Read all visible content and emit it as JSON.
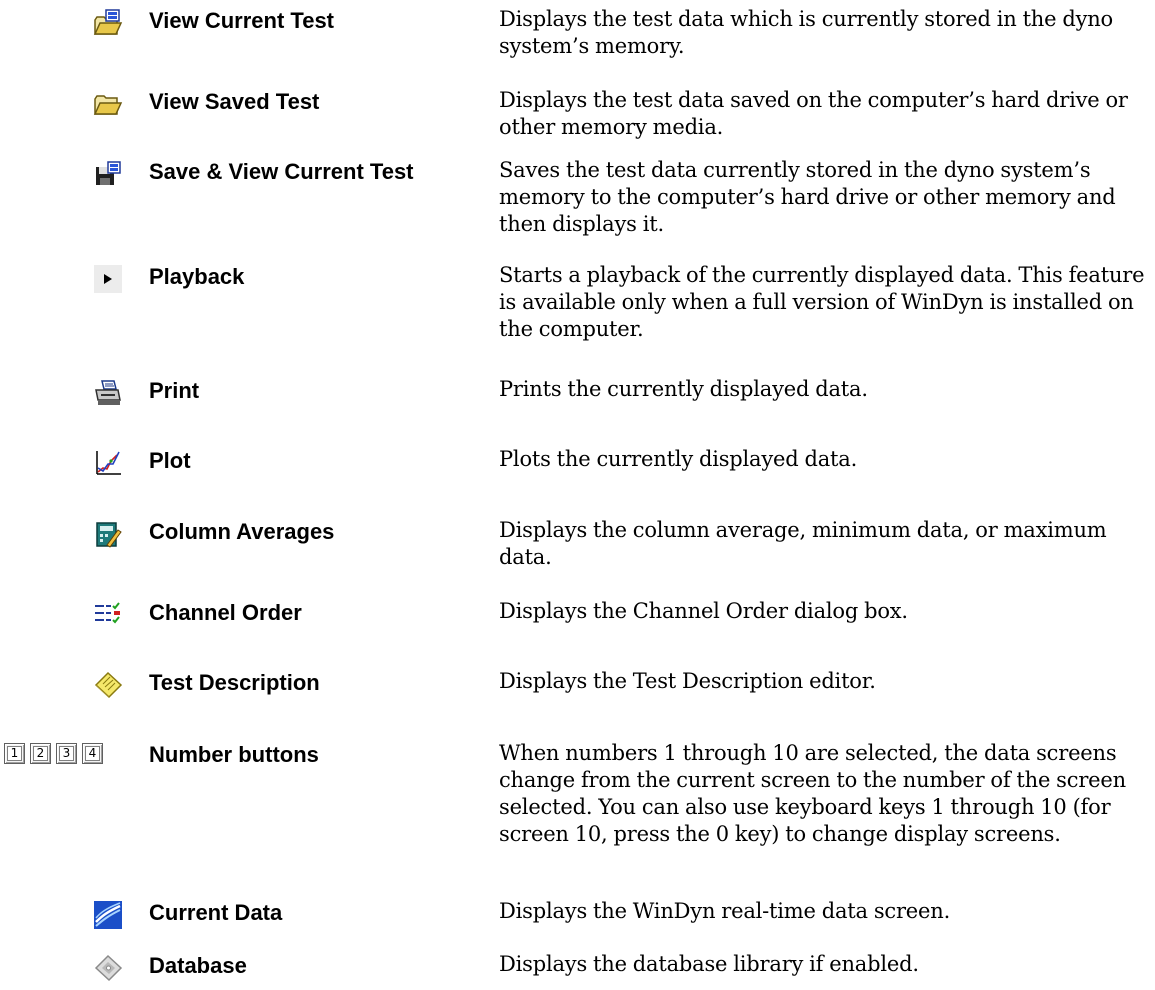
{
  "rows": [
    {
      "icon": "open-current-test-icon",
      "label": "View Current Test",
      "desc": "Displays the test data which is currently stored in the dyno system’s memory."
    },
    {
      "icon": "open-folder-icon",
      "label": "View Saved Test",
      "desc": "Displays the test data saved on the computer’s hard drive or other memory media."
    },
    {
      "icon": "save-disk-icon",
      "label": "Save & View Current Test",
      "desc": "Saves the test data currently stored in the dyno system’s memory to the computer’s hard drive or other memory and then displays it."
    },
    {
      "icon": "play-icon",
      "label": "Playback",
      "desc": "Starts a playback of the currently displayed data. This feature is available only when a full version of WinDyn is installed on the computer."
    },
    {
      "icon": "printer-icon",
      "label": "Print",
      "desc": "Prints the currently displayed data."
    },
    {
      "icon": "plot-chart-icon",
      "label": "Plot",
      "desc": "Plots the currently displayed data."
    },
    {
      "icon": "calculator-pencil-icon",
      "label": "Column Averages",
      "desc": "Displays the column average, minimum data, or maximum data."
    },
    {
      "icon": "channel-list-icon",
      "label": "Channel Order",
      "desc": "Displays the Channel Order dialog box."
    },
    {
      "icon": "note-pad-icon",
      "label": "Test Description",
      "desc": "Displays the Test Description editor."
    },
    {
      "icon": "number-buttons-icon",
      "label": "Number buttons",
      "numbers": [
        "1",
        "2",
        "3",
        "4"
      ],
      "desc": "When numbers 1 through 10 are selected, the data screens change from the current screen to the number of the screen selected. You can also use keyboard keys 1 through 10 (for screen 10, press the 0 key) to change display screens."
    },
    {
      "icon": "current-data-wave-icon",
      "label": "Current Data",
      "desc": "Displays the WinDyn real-time data screen."
    },
    {
      "icon": "database-disk-icon",
      "label": "Database",
      "desc": "Displays the database library if enabled."
    }
  ]
}
